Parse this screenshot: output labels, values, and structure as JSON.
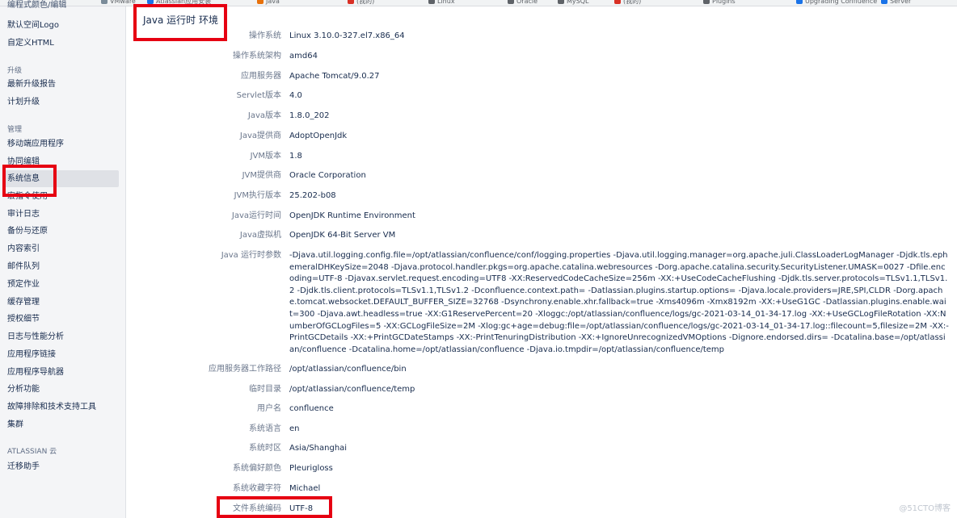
{
  "bookmarks": [
    "VMware",
    "Atlassian应用安装",
    "Java",
    "(我的)",
    "Linux",
    "Oracle",
    "MySQL",
    "(我的)",
    "Plugins",
    "Upgrading Confluence",
    "Server"
  ],
  "sidebar": {
    "partial_top": "编程式颜色/编辑",
    "items": [
      {
        "type": "item",
        "label": "默认空间Logo"
      },
      {
        "type": "item",
        "label": "自定义HTML"
      },
      {
        "type": "head",
        "label": "升级"
      },
      {
        "type": "item",
        "label": "最新升级报告"
      },
      {
        "type": "item",
        "label": "计划升级"
      },
      {
        "type": "head",
        "label": "管理"
      },
      {
        "type": "item",
        "label": "移动端应用程序"
      },
      {
        "type": "item",
        "label": "协同编辑"
      },
      {
        "type": "item",
        "label": "系统信息",
        "selected": true
      },
      {
        "type": "item",
        "label": "宏指令使用"
      },
      {
        "type": "item",
        "label": "审计日志"
      },
      {
        "type": "item",
        "label": "备份与还原"
      },
      {
        "type": "item",
        "label": "内容索引"
      },
      {
        "type": "item",
        "label": "邮件队列"
      },
      {
        "type": "item",
        "label": "预定作业"
      },
      {
        "type": "item",
        "label": "缓存管理"
      },
      {
        "type": "item",
        "label": "授权细节"
      },
      {
        "type": "item",
        "label": "日志与性能分析"
      },
      {
        "type": "item",
        "label": "应用程序链接"
      },
      {
        "type": "item",
        "label": "应用程序导航器"
      },
      {
        "type": "item",
        "label": "分析功能"
      },
      {
        "type": "item",
        "label": "故障排除和技术支持工具"
      },
      {
        "type": "item",
        "label": "集群"
      },
      {
        "type": "head",
        "label": "ATLASSIAN 云"
      },
      {
        "type": "item",
        "label": "迁移助手"
      }
    ]
  },
  "section_title": "Java 运行时 环境",
  "rows": [
    {
      "label": "操作系统",
      "value": "Linux 3.10.0-327.el7.x86_64"
    },
    {
      "label": "操作系统架构",
      "value": "amd64"
    },
    {
      "label": "应用服务器",
      "value": "Apache Tomcat/9.0.27"
    },
    {
      "label": "Servlet版本",
      "value": "4.0"
    },
    {
      "label": "Java版本",
      "value": "1.8.0_202"
    },
    {
      "label": "Java提供商",
      "value": "AdoptOpenJdk"
    },
    {
      "label": "JVM版本",
      "value": "1.8"
    },
    {
      "label": "JVM提供商",
      "value": "Oracle Corporation"
    },
    {
      "label": "JVM执行版本",
      "value": "25.202-b08"
    },
    {
      "label": "Java运行时间",
      "value": "OpenJDK Runtime Environment"
    },
    {
      "label": "Java虚拟机",
      "value": "OpenJDK 64-Bit Server VM"
    },
    {
      "label": "Java 运行时参数",
      "value": "-Djava.util.logging.config.file=/opt/atlassian/confluence/conf/logging.properties -Djava.util.logging.manager=org.apache.juli.ClassLoaderLogManager -Djdk.tls.ephemeralDHKeySize=2048 -Djava.protocol.handler.pkgs=org.apache.catalina.webresources -Dorg.apache.catalina.security.SecurityListener.UMASK=0027 -Dfile.encoding=UTF-8 -Djavax.servlet.request.encoding=UTF8 -XX:ReservedCodeCacheSize=256m -XX:+UseCodeCacheFlushing -Djdk.tls.server.protocols=TLSv1.1,TLSv1.2 -Djdk.tls.client.protocols=TLSv1.1,TLSv1.2 -Dconfluence.context.path= -Datlassian.plugins.startup.options= -Djava.locale.providers=JRE,SPI,CLDR -Dorg.apache.tomcat.websocket.DEFAULT_BUFFER_SIZE=32768 -Dsynchrony.enable.xhr.fallback=true -Xms4096m -Xmx8192m -XX:+UseG1GC -Datlassian.plugins.enable.wait=300 -Djava.awt.headless=true -XX:G1ReservePercent=20 -Xloggc:/opt/atlassian/confluence/logs/gc-2021-03-14_01-34-17.log -XX:+UseGCLogFileRotation -XX:NumberOfGCLogFiles=5 -XX:GCLogFileSize=2M -Xlog:gc+age=debug:file=/opt/atlassian/confluence/logs/gc-2021-03-14_01-34-17.log::filecount=5,filesize=2M -XX:-PrintGCDetails -XX:+PrintGCDateStamps -XX:-PrintTenuringDistribution -XX:+IgnoreUnrecognizedVMOptions -Dignore.endorsed.dirs= -Dcatalina.base=/opt/atlassian/confluence -Dcatalina.home=/opt/atlassian/confluence -Djava.io.tmpdir=/opt/atlassian/confluence/temp",
      "multiline": true
    },
    {
      "label": "应用服务器工作路径",
      "value": "/opt/atlassian/confluence/bin"
    },
    {
      "label": "临时目录",
      "value": "/opt/atlassian/confluence/temp"
    },
    {
      "label": "用户名",
      "value": "confluence"
    },
    {
      "label": "系统语言",
      "value": "en"
    },
    {
      "label": "系统时区",
      "value": "Asia/Shanghai"
    },
    {
      "label": "系统偏好颜色",
      "value": "Pleurigloss"
    },
    {
      "label": "系统收藏字符",
      "value": "Michael"
    },
    {
      "label": "文件系统编码",
      "value": "UTF-8"
    }
  ],
  "watermark": "@51CTO博客",
  "colors": {
    "highlight": "#e60012",
    "sidebar_bg": "#f4f5f7",
    "selected_bg": "#dfe1e6",
    "label": "#6b778c",
    "text": "#172b4d"
  }
}
